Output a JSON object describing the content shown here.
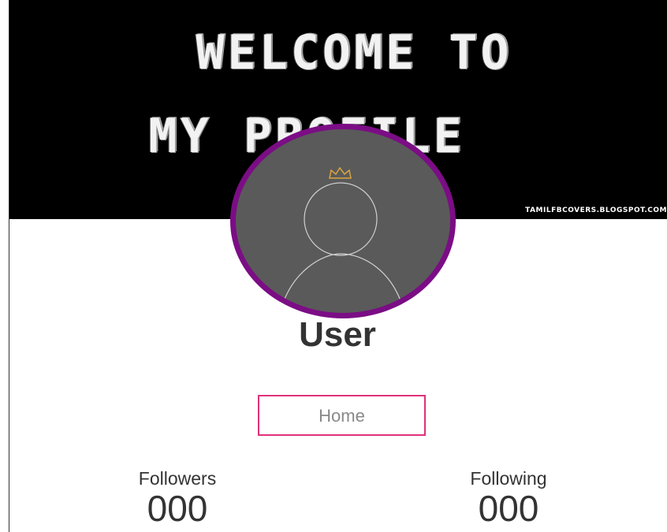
{
  "cover": {
    "line1": "WELCOME TO",
    "line2": "MY PROFILE",
    "credit": "TAMILFBCOVERS.BLOGSPOT.COM"
  },
  "profile": {
    "avatar_icon": "default-user-icon",
    "crown_icon": "crown-icon",
    "name": "User",
    "ring_color": "#7b0d85"
  },
  "nav": {
    "home_label": "Home",
    "accent_color": "#e0317a"
  },
  "stats": {
    "followers_label": "Followers",
    "followers_value": "000",
    "following_label": "Following",
    "following_value": "000"
  }
}
